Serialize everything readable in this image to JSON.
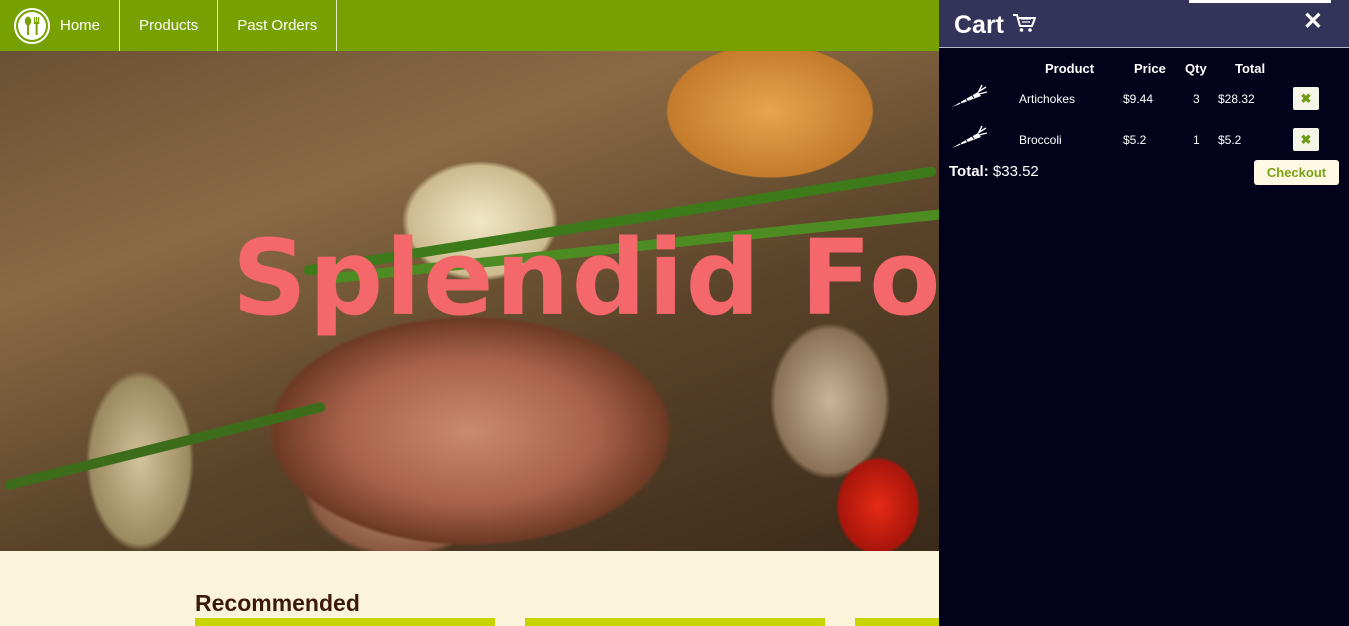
{
  "nav": {
    "items": [
      {
        "label": "Home"
      },
      {
        "label": "Products"
      },
      {
        "label": "Past Orders"
      }
    ]
  },
  "hero": {
    "title": "Splendid Fo"
  },
  "main": {
    "section_title": "Recommended"
  },
  "cart": {
    "title": "Cart",
    "columns": [
      "Product",
      "Price",
      "Qty",
      "Total"
    ],
    "items": [
      {
        "product": "Artichokes",
        "price": "$9.44",
        "qty": "3",
        "total": "$28.32"
      },
      {
        "product": "Broccoli",
        "price": "$5.2",
        "qty": "1",
        "total": "$5.2"
      }
    ],
    "total_label": "Total:",
    "total_value": "$33.52",
    "checkout_label": "Checkout",
    "remove_glyph": "✖",
    "close_glyph": "✕"
  },
  "colors": {
    "nav": "#77a100",
    "cart_bg": "#02021a",
    "cart_header": "#34345a",
    "hero_title": "#f4676a",
    "accent": "#7aa214"
  },
  "icons": {
    "logo": "fork-spoon-icon",
    "cart": "shopping-cart-icon",
    "row": "carrot-icon",
    "remove": "remove-icon",
    "close": "close-icon"
  }
}
